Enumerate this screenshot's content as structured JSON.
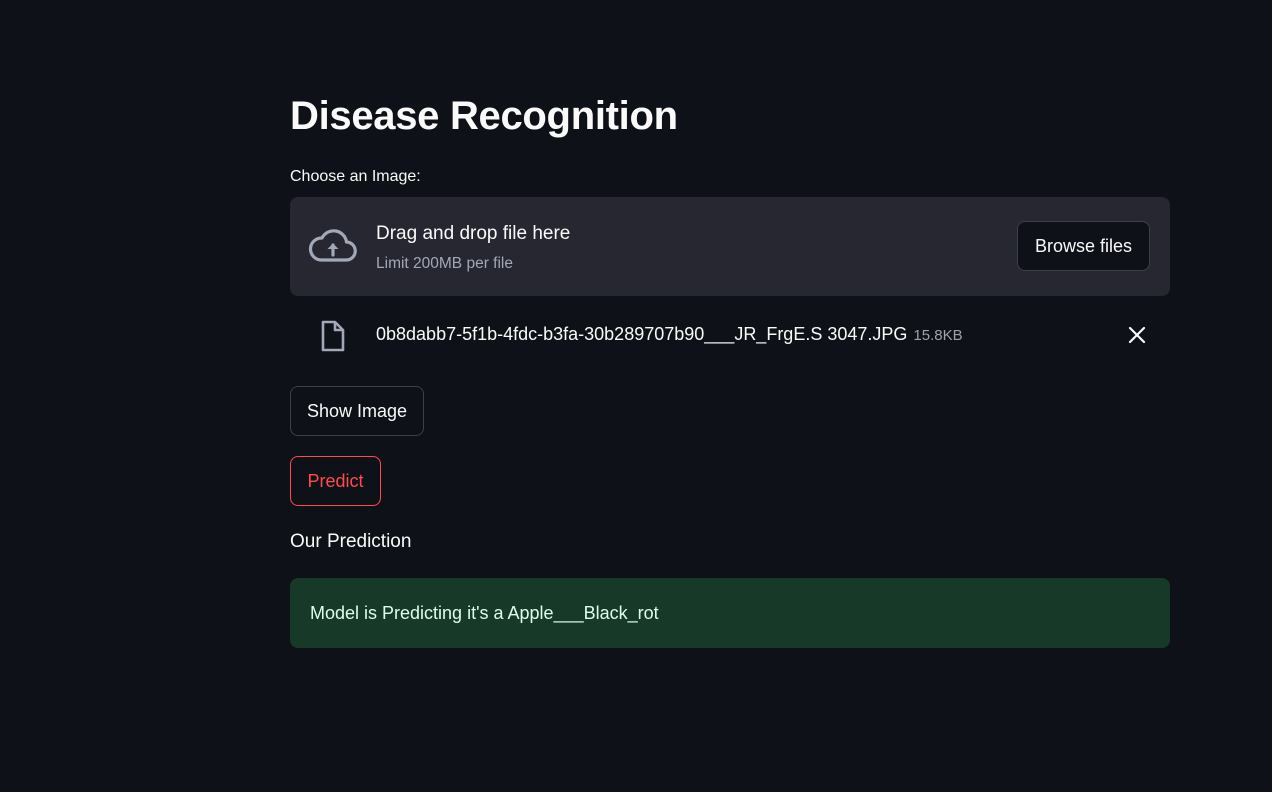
{
  "header": {
    "title": "Disease Recognition"
  },
  "uploader": {
    "label": "Choose an Image:",
    "dropzone_title": "Drag and drop file here",
    "dropzone_limit": "Limit 200MB per file",
    "browse_label": "Browse files",
    "upload_icon": "cloud-upload-icon"
  },
  "uploaded_file": {
    "name": "0b8dabb7-5f1b-4fdc-b3fa-30b289707b90___JR_FrgE.S 3047.JPG",
    "size": "15.8KB",
    "file_icon": "file-icon",
    "remove_icon": "close-icon"
  },
  "actions": {
    "show_image_label": "Show Image",
    "predict_label": "Predict"
  },
  "prediction": {
    "heading": "Our Prediction",
    "result_text": "Model is Predicting it's a Apple___Black_rot"
  },
  "colors": {
    "background": "#0e1117",
    "dropzone": "#262730",
    "primary": "#ff4b4b",
    "success_bg": "#173928",
    "success_text": "#dffde9"
  }
}
